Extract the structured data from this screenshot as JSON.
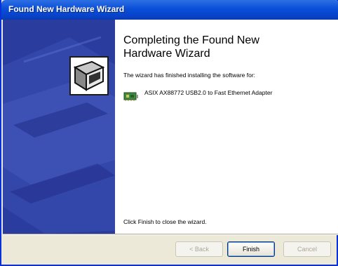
{
  "window": {
    "title": "Found New Hardware Wizard"
  },
  "content": {
    "heading": "Completing the Found New Hardware Wizard",
    "subtext": "The wizard has finished installing the software for:",
    "device_name": "ASIX AX88772 USB2.0 to Fast Ethernet Adapter",
    "footer_text": "Click Finish to close the wizard."
  },
  "buttons": {
    "back_label": "< Back",
    "finish_label": "Finish",
    "cancel_label": "Cancel"
  },
  "icons": {
    "wizard": "hardware-wizard-icon",
    "device": "network-adapter-icon"
  },
  "colors": {
    "titlebar": "#0a4ed8",
    "side_panel": "#2a3d9f",
    "dialog_bg": "#ece9d8"
  }
}
